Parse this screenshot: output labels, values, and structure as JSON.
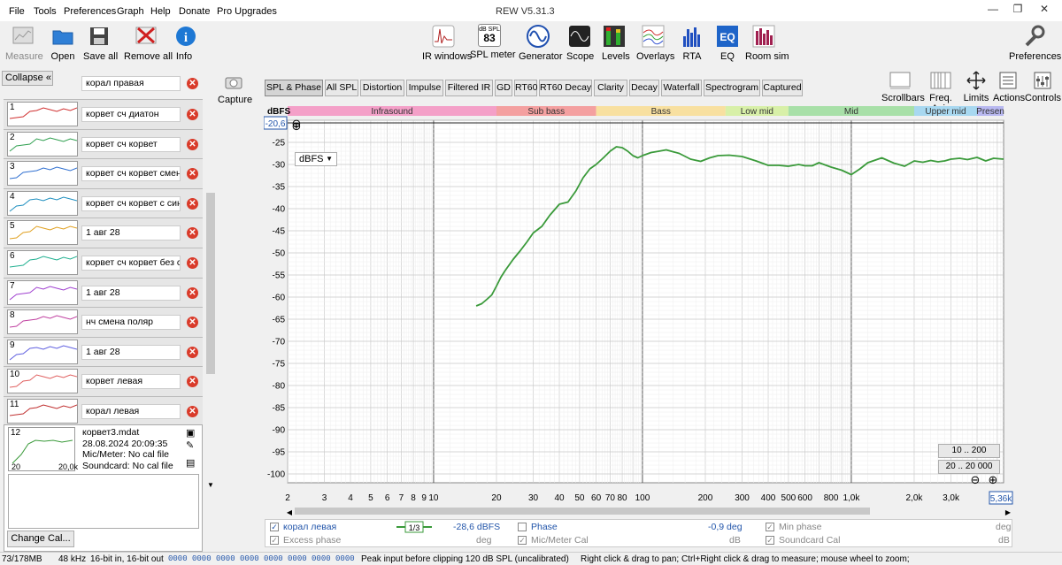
{
  "menu": [
    "File",
    "Tools",
    "Preferences",
    "Graph",
    "Help",
    "Donate",
    "Pro Upgrades"
  ],
  "window_title": "REW V5.31.3",
  "toolbar_left": [
    "Measure",
    "Open",
    "Save all",
    "Remove all",
    "Info"
  ],
  "toolbar_center": [
    "IR windows",
    "SPL meter",
    "Generator",
    "Scope",
    "Levels",
    "Overlays",
    "RTA",
    "EQ",
    "Room sim"
  ],
  "spl_value": "83",
  "spl_unit": "dB SPL",
  "preferences_label": "Preferences",
  "collapse_label": "Collapse",
  "top_measurement_name": "корал правая",
  "measurements": [
    {
      "num": "1",
      "name": "корвет сч диатон",
      "color": "#d03030"
    },
    {
      "num": "2",
      "name": "корвет сч корвет",
      "color": "#30a050"
    },
    {
      "num": "3",
      "name": "корвет сч корвет смена",
      "color": "#3070d0"
    },
    {
      "num": "4",
      "name": "корвет сч корвет с синт",
      "color": "#2090c0"
    },
    {
      "num": "5",
      "name": "1 авг 28",
      "color": "#e0a020"
    },
    {
      "num": "6",
      "name": "корвет сч корвет без си",
      "color": "#20b090"
    },
    {
      "num": "7",
      "name": "1 авг 28",
      "color": "#a040d0"
    },
    {
      "num": "8",
      "name": "нч смена поляр",
      "color": "#c040a0"
    },
    {
      "num": "9",
      "name": "1 авг 28",
      "color": "#6060e0"
    },
    {
      "num": "10",
      "name": "корвет левая",
      "color": "#e06060"
    },
    {
      "num": "11",
      "name": "корал левая",
      "color": "#c03030"
    }
  ],
  "selected": {
    "num": "12",
    "file": "корвет3.mdat",
    "date": "28.08.2024 20:09:35",
    "mic": "Mic/Meter: No cal file",
    "soundcard": "Soundcard: No cal file",
    "x_min": "20",
    "x_max": "20,0k"
  },
  "change_cal": "Change Cal...",
  "capture_label": "Capture",
  "graph_tabs": [
    "SPL & Phase",
    "All SPL",
    "Distortion",
    "Impulse",
    "Filtered IR",
    "GD",
    "RT60",
    "RT60 Decay",
    "Clarity",
    "Decay",
    "Waterfall",
    "Spectrogram",
    "Captured"
  ],
  "right_tools": [
    "Scrollbars",
    "Freq. Axis",
    "Limits",
    "Actions",
    "Controls"
  ],
  "bands": [
    {
      "label": "Infrasound",
      "from": 2,
      "to": 20,
      "color": "#f4a0c8"
    },
    {
      "label": "Sub bass",
      "from": 20,
      "to": 60,
      "color": "#f4a0a0"
    },
    {
      "label": "Bass",
      "from": 60,
      "to": 250,
      "color": "#f8e0a0"
    },
    {
      "label": "Low mid",
      "from": 250,
      "to": 500,
      "color": "#d8f0a8"
    },
    {
      "label": "Mid",
      "from": 500,
      "to": 2000,
      "color": "#a8e0a8"
    },
    {
      "label": "Upper mid",
      "from": 2000,
      "to": 4000,
      "color": "#a8d8f0"
    },
    {
      "label": "Presen",
      "from": 4000,
      "to": 5360,
      "color": "#b8b8f0"
    }
  ],
  "yaxis_unit": "dBFS",
  "cursor_value": "-20,6",
  "unit_select": "dBFS",
  "range_buttons": [
    "10 .. 200",
    "20 .. 20 000"
  ],
  "freq_cursor": "5,36k",
  "chart_data": {
    "type": "line",
    "xscale": "log",
    "xlim": [
      2,
      5360
    ],
    "ylim": [
      -102,
      -20
    ],
    "xlabel": "",
    "ylabel": "dBFS",
    "x_ticks": [
      "2",
      "3",
      "4",
      "5",
      "6",
      "7",
      "8",
      "9",
      "10",
      "20",
      "30",
      "40",
      "50",
      "60",
      "70",
      "80",
      "100",
      "200",
      "300",
      "400",
      "500",
      "600",
      "800",
      "1,0k",
      "2,0k",
      "3,0k",
      "5,"
    ],
    "y_ticks": [
      "-25",
      "-30",
      "-35",
      "-40",
      "-45",
      "-50",
      "-55",
      "-60",
      "-65",
      "-70",
      "-75",
      "-80",
      "-85",
      "-90",
      "-95",
      "-100"
    ],
    "series": [
      {
        "name": "корал левая",
        "color": "#3a9a3a",
        "x": [
          16,
          17,
          18,
          19,
          20,
          21,
          22,
          24,
          26,
          28,
          30,
          33,
          36,
          40,
          44,
          48,
          52,
          56,
          60,
          65,
          70,
          75,
          80,
          85,
          90,
          95,
          100,
          110,
          120,
          130,
          150,
          170,
          190,
          210,
          230,
          260,
          300,
          350,
          400,
          450,
          500,
          560,
          600,
          650,
          700,
          800,
          900,
          1000,
          1100,
          1200,
          1400,
          1600,
          1800,
          2000,
          2200,
          2400,
          2600,
          2800,
          3000,
          3300,
          3600,
          4000,
          4400,
          4800,
          5360
        ],
        "y": [
          -62,
          -61.5,
          -60.5,
          -59.5,
          -57.5,
          -55.5,
          -54,
          -51.5,
          -49.5,
          -47.5,
          -45.5,
          -44,
          -41.5,
          -39,
          -38.5,
          -36,
          -33,
          -31,
          -30,
          -28.5,
          -27,
          -26,
          -26.2,
          -27,
          -28,
          -28.5,
          -28,
          -27.3,
          -27,
          -26.7,
          -27.5,
          -28.8,
          -29.3,
          -28.5,
          -28,
          -27.9,
          -28.2,
          -29.2,
          -30.2,
          -30.2,
          -30.4,
          -30,
          -30.3,
          -30.3,
          -29.6,
          -30.6,
          -31.3,
          -32.3,
          -31,
          -29.6,
          -28.5,
          -29.7,
          -30.4,
          -29.2,
          -29.5,
          -29.1,
          -29.4,
          -29.2,
          -28.8,
          -28.6,
          -28.9,
          -28.4,
          -29.2,
          -28.6,
          -28.8
        ]
      }
    ]
  },
  "bottom_row1": {
    "name": "корал левая",
    "smooth": "1/3",
    "value": "-28,6 dBFS",
    "phase": "Phase",
    "phase_value": "-0,9 deg",
    "min_phase": "Min phase",
    "unit": "deg"
  },
  "bottom_row2": {
    "excess": "Excess phase",
    "deg": "deg",
    "micmeter": "Mic/Meter Cal",
    "db1": "dB",
    "soundcard": "Soundcard Cal",
    "db2": "dB"
  },
  "status": {
    "mem": "73/178MB",
    "rate": "48 kHz",
    "bits": "16-bit in, 16-bit out",
    "levels": "0000 0000  0000 0000  0000 0000  0000 0000",
    "peak": "Peak input before clipping 120 dB SPL (uncalibrated)",
    "hint": "Right click & drag to pan; Ctrl+Right click & drag to measure; mouse wheel to zoom;"
  }
}
